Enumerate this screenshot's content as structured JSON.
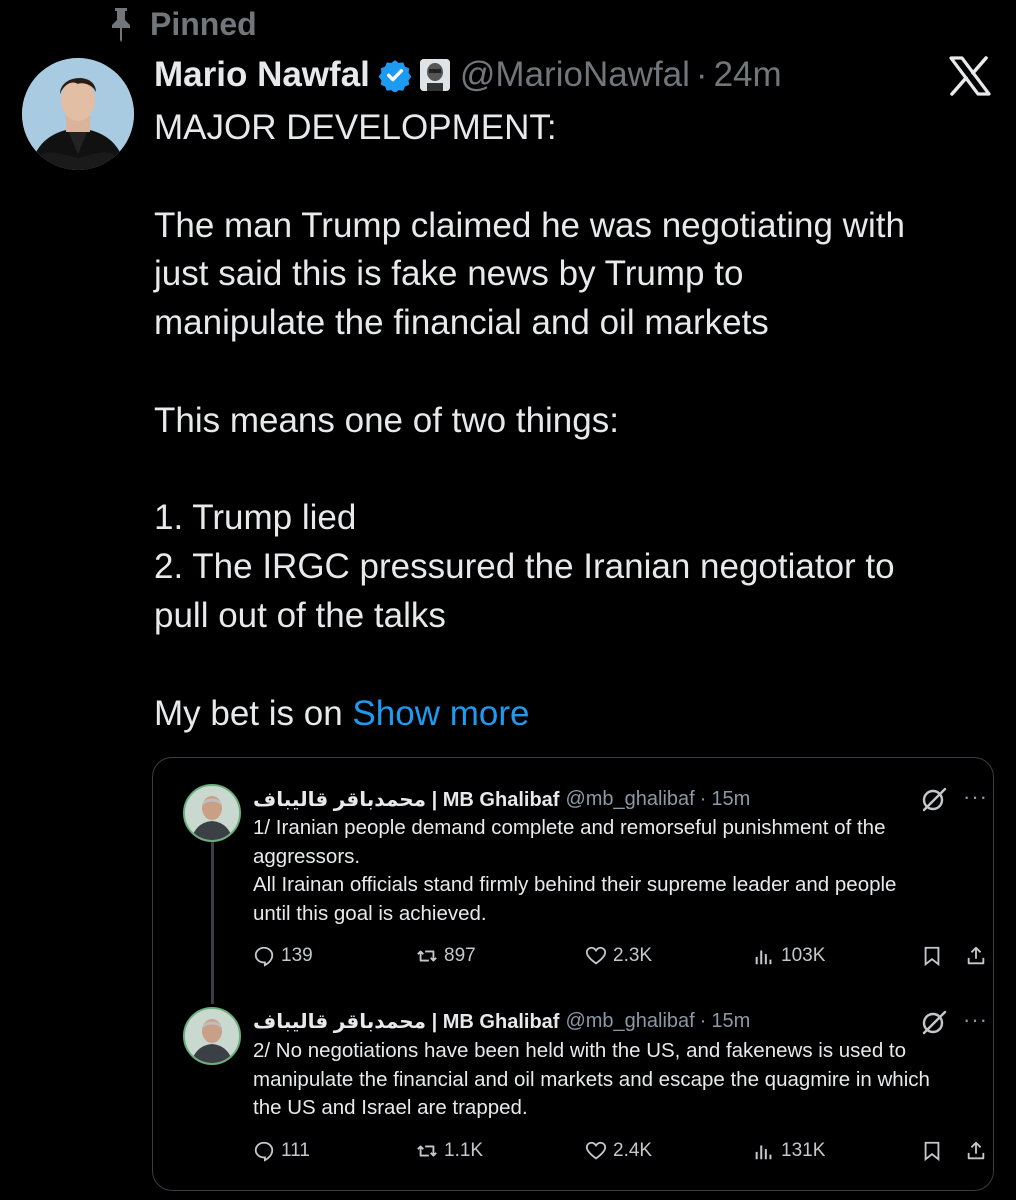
{
  "pinned_label": "Pinned",
  "author": {
    "name": "Mario Nawfal",
    "handle": "@MarioNawfal",
    "time": "24m"
  },
  "body_lines": [
    "MAJOR DEVELOPMENT:",
    "",
    "The man Trump claimed he was negotiating with",
    "just said this is fake news by Trump to",
    "manipulate the financial and oil markets",
    "",
    "This means one of two things:",
    "",
    "1. Trump lied",
    "2. The IRGC pressured the Iranian negotiator to",
    "pull out of the talks",
    ""
  ],
  "last_line_prefix": "My bet is on ",
  "show_more": "Show more",
  "quoted": [
    {
      "name": "محمدباقر قالیباف | MB Ghalibaf",
      "handle": "@mb_ghalibaf",
      "time": "15m",
      "more": "···",
      "lines": [
        "1/ Iranian people demand complete and remorseful punishment of the",
        "aggressors.",
        "All Irainan officials stand firmly behind their supreme leader and people",
        "until this goal is achieved."
      ],
      "replies": "139",
      "reposts": "897",
      "likes": "2.3K",
      "views": "103K"
    },
    {
      "name": "محمدباقر قالیباف | MB Ghalibaf",
      "handle": "@mb_ghalibaf",
      "time": "15m",
      "more": "···",
      "lines": [
        "2/ No negotiations have been held with the US, and fakenews is used to",
        "manipulate the financial and oil markets and escape the quagmire in which",
        "the US and Israel are trapped."
      ],
      "replies": "111",
      "reposts": "1.1K",
      "likes": "2.4K",
      "views": "131K"
    }
  ],
  "colors": {
    "background": "#000000",
    "text": "#e7e9ea",
    "muted": "#71767b",
    "link": "#1d9bf0",
    "verified": "#1d9bf0"
  },
  "icons": [
    "pin-icon",
    "verified-badge-icon",
    "affiliate-badge-icon",
    "x-logo-icon",
    "grok-icon",
    "reply-icon",
    "repost-icon",
    "like-icon",
    "views-icon",
    "bookmark-icon",
    "share-icon"
  ]
}
